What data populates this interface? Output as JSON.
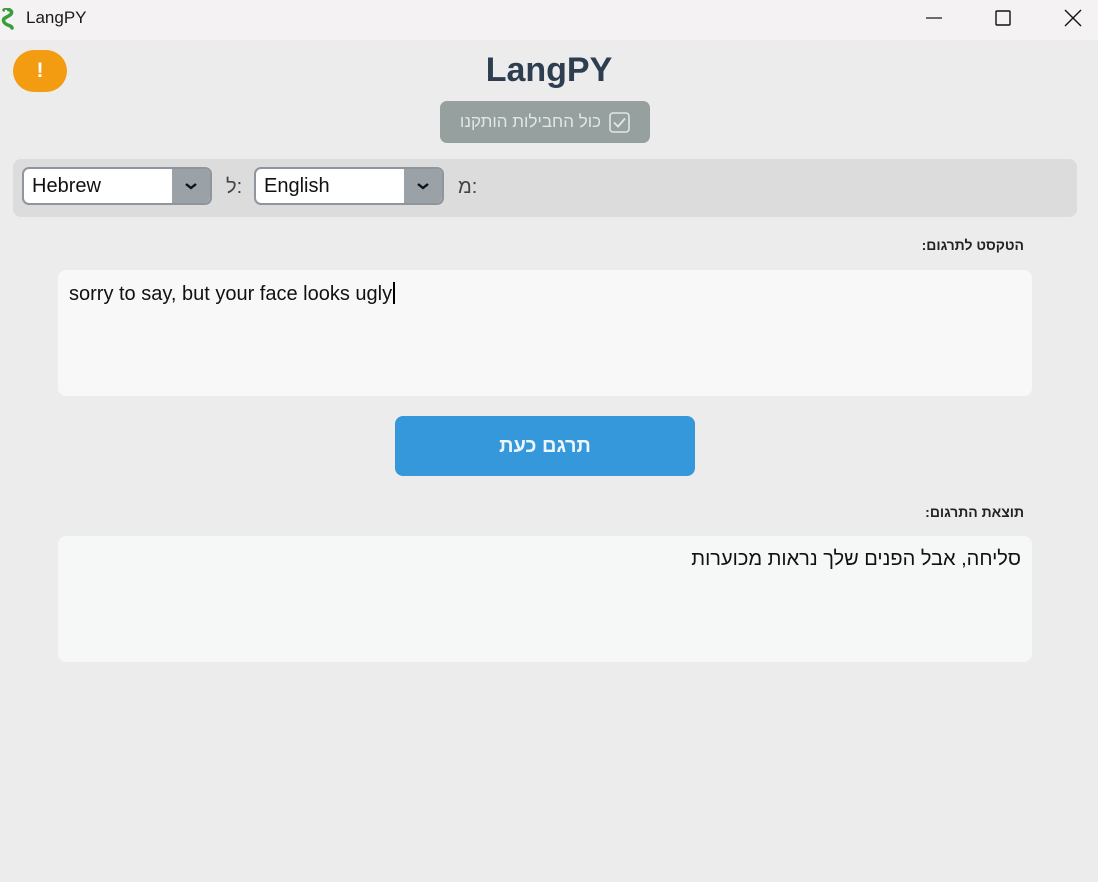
{
  "window": {
    "title": "LangPY",
    "icon": "python-snake-icon",
    "controls": [
      "minimize-icon",
      "maximize-icon",
      "close-icon"
    ]
  },
  "header": {
    "warning_label": "!",
    "app_title": "LangPY",
    "status_text": "כול החבילות הותקנו",
    "status_icon": "checkbox-check-icon"
  },
  "languages": {
    "from_label": "מ:",
    "to_label": "ל:",
    "source_language": "English",
    "target_language": "Hebrew"
  },
  "source": {
    "label": "הטקסט לתרגום:",
    "text": "sorry to say, but your face looks ugly"
  },
  "translate_button": "תרגם כעת",
  "result": {
    "label": "תוצאת התרגום:",
    "text": "סליחה, אבל הפנים שלך נראות מכוערות"
  },
  "colors": {
    "accent": "#3498db",
    "warning": "#f39c12",
    "title": "#2c3e50",
    "status_badge": "#95a09f"
  }
}
